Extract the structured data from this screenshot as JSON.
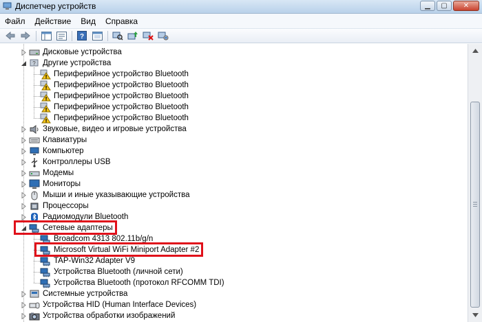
{
  "window": {
    "title": "Диспетчер устройств"
  },
  "menu": [
    "Файл",
    "Действие",
    "Вид",
    "Справка"
  ],
  "toolbar_icons": [
    "back-arrow-icon",
    "forward-arrow-icon",
    "console-tree-icon",
    "properties-icon",
    "help-icon",
    "refresh-icon",
    "scan-hardware-icon",
    "update-driver-icon",
    "disable-device-icon",
    "uninstall-device-icon"
  ],
  "tree": [
    {
      "label": "Дисковые устройства",
      "level": 0,
      "expander": "collapsed",
      "icon": "disk-drive-icon"
    },
    {
      "label": "Другие устройства",
      "level": 0,
      "expander": "expanded",
      "icon": "unknown-device-icon"
    },
    {
      "label": "Периферийное устройство Bluetooth",
      "level": 1,
      "icon": "warning-device-icon"
    },
    {
      "label": "Периферийное устройство Bluetooth",
      "level": 1,
      "icon": "warning-device-icon"
    },
    {
      "label": "Периферийное устройство Bluetooth",
      "level": 1,
      "icon": "warning-device-icon"
    },
    {
      "label": "Периферийное устройство Bluetooth",
      "level": 1,
      "icon": "warning-device-icon"
    },
    {
      "label": "Периферийное устройство Bluetooth",
      "level": 1,
      "icon": "warning-device-icon"
    },
    {
      "label": "Звуковые, видео и игровые устройства",
      "level": 0,
      "expander": "collapsed",
      "icon": "speaker-icon"
    },
    {
      "label": "Клавиатуры",
      "level": 0,
      "expander": "collapsed",
      "icon": "keyboard-icon"
    },
    {
      "label": "Компьютер",
      "level": 0,
      "expander": "collapsed",
      "icon": "computer-icon"
    },
    {
      "label": "Контроллеры USB",
      "level": 0,
      "expander": "collapsed",
      "icon": "usb-icon"
    },
    {
      "label": "Модемы",
      "level": 0,
      "expander": "collapsed",
      "icon": "modem-icon"
    },
    {
      "label": "Мониторы",
      "level": 0,
      "expander": "collapsed",
      "icon": "monitor-icon"
    },
    {
      "label": "Мыши и иные указывающие устройства",
      "level": 0,
      "expander": "collapsed",
      "icon": "mouse-icon"
    },
    {
      "label": "Процессоры",
      "level": 0,
      "expander": "collapsed",
      "icon": "processor-icon"
    },
    {
      "label": "Радиомодули Bluetooth",
      "level": 0,
      "expander": "collapsed",
      "icon": "bluetooth-icon"
    },
    {
      "label": "Сетевые адаптеры",
      "level": 0,
      "expander": "expanded",
      "icon": "network-adapter-icon",
      "highlight": true
    },
    {
      "label": "Broadcom 4313 802.11b/g/n",
      "level": 1,
      "icon": "network-adapter-icon"
    },
    {
      "label": "Microsoft Virtual WiFi Miniport Adapter #2",
      "level": 1,
      "icon": "network-adapter-icon",
      "highlight": true
    },
    {
      "label": "TAP-Win32 Adapter V9",
      "level": 1,
      "icon": "network-adapter-icon"
    },
    {
      "label": "Устройства Bluetooth (личной сети)",
      "level": 1,
      "icon": "network-adapter-icon"
    },
    {
      "label": "Устройства Bluetooth (протокол RFCOMM TDI)",
      "level": 1,
      "icon": "network-adapter-icon"
    },
    {
      "label": "Системные устройства",
      "level": 0,
      "expander": "collapsed",
      "icon": "system-device-icon"
    },
    {
      "label": "Устройства HID (Human Interface Devices)",
      "level": 0,
      "expander": "collapsed",
      "icon": "hid-icon"
    },
    {
      "label": "Устройства обработки изображений",
      "level": 0,
      "expander": "collapsed",
      "icon": "camera-icon"
    }
  ],
  "colors": {
    "highlight_border": "#e0101a",
    "warning_yellow": "#f5c518",
    "device_blue": "#2f6fb5"
  }
}
